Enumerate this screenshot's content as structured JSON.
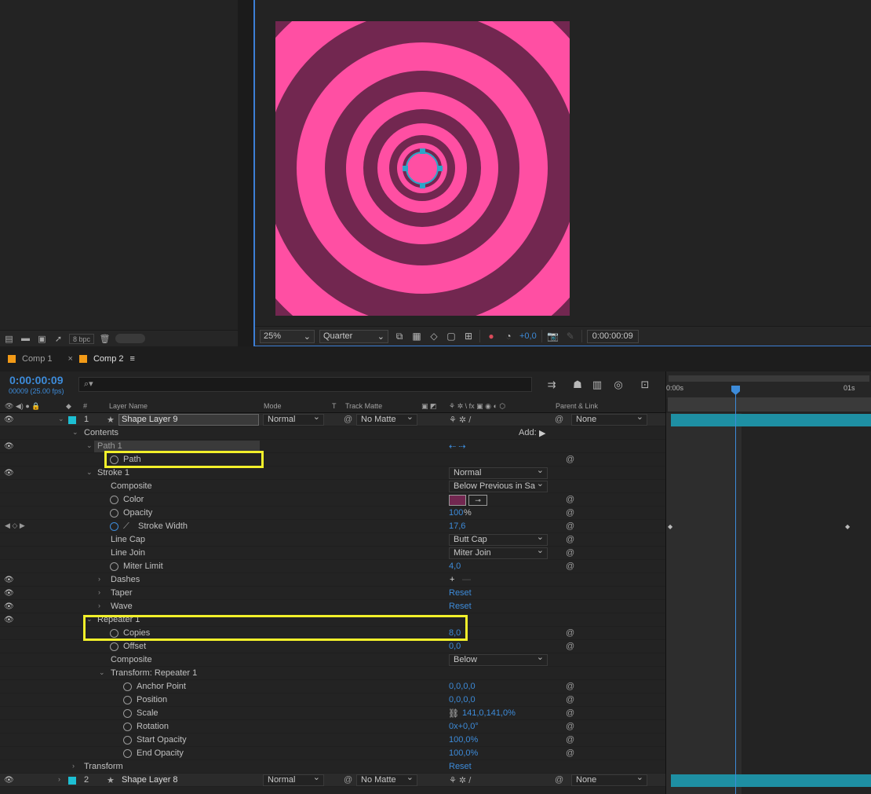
{
  "project": {
    "bpc": "8 bpc"
  },
  "viewer": {
    "zoom": "25%",
    "resolution": "Quarter",
    "exposure": "+0,0",
    "timecode": "0:00:00:09",
    "canvas_bg": "#722750",
    "ring_color": "#ff4fa3"
  },
  "tabs": [
    {
      "label": "Comp 1",
      "color": "#f29a17"
    },
    {
      "label": "Comp 2",
      "color": "#f29a17"
    }
  ],
  "timeline": {
    "timecode": "0:00:00:09",
    "fps": "00009 (25.00 fps)",
    "search_placeholder": "",
    "ruler": {
      "start": "0:00s",
      "end": "01s"
    }
  },
  "columns": {
    "num": "#",
    "layer_name": "Layer Name",
    "mode": "Mode",
    "t": "T",
    "track_matte": "Track Matte",
    "parent": "Parent & Link"
  },
  "layer1": {
    "index": "1",
    "name": "Shape Layer 9",
    "mode": "Normal",
    "matte": "No Matte",
    "parent": "None"
  },
  "layer2": {
    "index": "2",
    "name": "Shape Layer 8",
    "mode": "Normal",
    "matte": "No Matte",
    "parent": "None"
  },
  "props": {
    "contents": "Contents",
    "add": "Add:",
    "path_group": "Path 1",
    "path": "Path",
    "stroke": "Stroke 1",
    "composite": "Composite",
    "stroke_mode": "Normal",
    "stroke_composite": "Below Previous in Sa",
    "color": "Color",
    "opacity": "Opacity",
    "opacity_val": "100",
    "pct": "%",
    "stroke_width": "Stroke Width",
    "stroke_width_val": "17,6",
    "line_cap": "Line Cap",
    "line_cap_val": "Butt Cap",
    "line_join": "Line Join",
    "line_join_val": "Miter Join",
    "miter_limit": "Miter Limit",
    "miter_limit_val": "4,0",
    "dashes": "Dashes",
    "taper": "Taper",
    "taper_val": "Reset",
    "wave": "Wave",
    "wave_val": "Reset",
    "repeater": "Repeater 1",
    "copies": "Copies",
    "copies_val": "8,0",
    "offset": "Offset",
    "offset_val": "0,0",
    "rep_composite_val": "Below",
    "transform_rep": "Transform: Repeater 1",
    "anchor": "Anchor Point",
    "anchor_val": "0,0,0,0",
    "position": "Position",
    "position_val": "0,0,0,0",
    "scale": "Scale",
    "scale_val": "141,0,141,0%",
    "rotation": "Rotation",
    "rotation_val": "0x+0,0°",
    "start_opacity": "Start Opacity",
    "start_opacity_val": "100,0%",
    "end_opacity": "End Opacity",
    "end_opacity_val": "100,0%",
    "transform": "Transform",
    "transform_val": "Reset"
  }
}
